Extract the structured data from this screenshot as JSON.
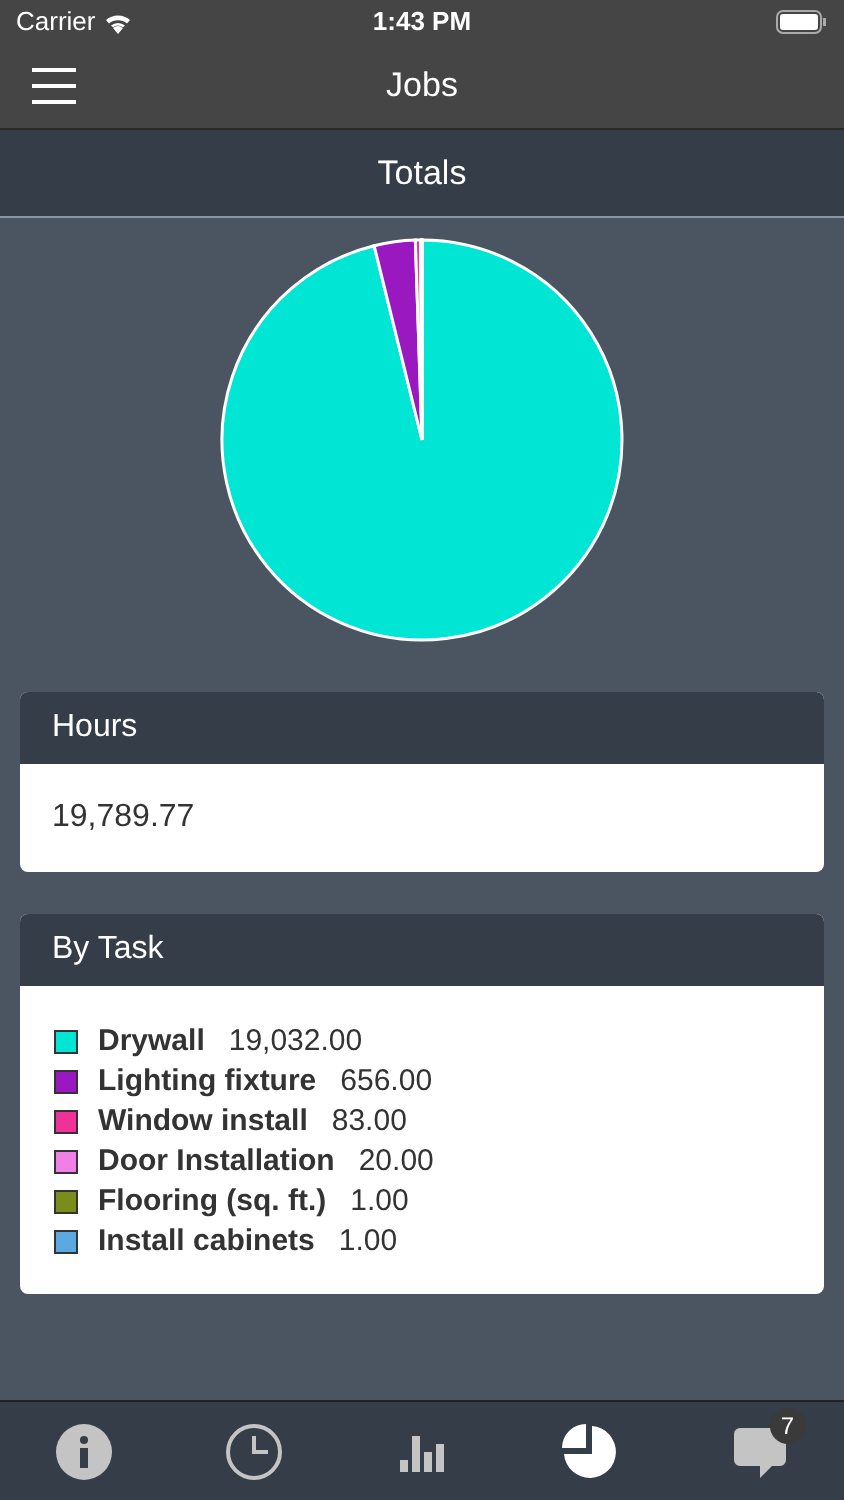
{
  "status_bar": {
    "carrier": "Carrier",
    "time": "1:43 PM"
  },
  "nav": {
    "title": "Jobs"
  },
  "section": {
    "title": "Totals"
  },
  "hours": {
    "title": "Hours",
    "value": "19,789.77"
  },
  "by_task": {
    "title": "By Task",
    "items": [
      {
        "name": "Drywall",
        "value": "19,032.00",
        "color": "#00e5d4"
      },
      {
        "name": "Lighting fixture",
        "value": "656.00",
        "color": "#9a18c0"
      },
      {
        "name": "Window install",
        "value": "83.00",
        "color": "#f0319a"
      },
      {
        "name": "Door Installation",
        "value": "20.00",
        "color": "#f07fe8"
      },
      {
        "name": "Flooring (sq. ft.)",
        "value": "1.00",
        "color": "#7a8c1a"
      },
      {
        "name": "Install cabinets",
        "value": "1.00",
        "color": "#5ba9e0"
      }
    ]
  },
  "tab_bar": [
    {
      "kind": "info",
      "selected": false
    },
    {
      "kind": "clock",
      "selected": false
    },
    {
      "kind": "bars",
      "selected": false
    },
    {
      "kind": "pie",
      "selected": true
    },
    {
      "kind": "chat",
      "selected": false,
      "badge": "7"
    }
  ]
}
